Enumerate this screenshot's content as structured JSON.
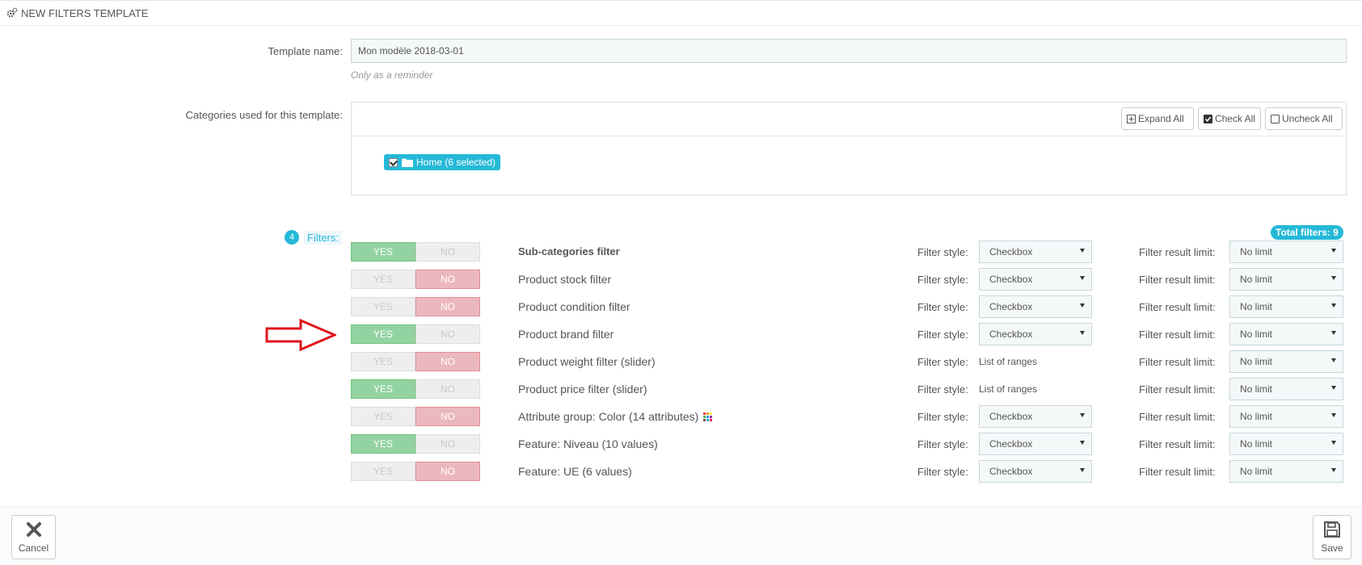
{
  "panel": {
    "title": "New filters template"
  },
  "form": {
    "template_name_label": "Template name:",
    "template_name_value": "Mon modèle 2018-03-01",
    "template_name_help": "Only as a reminder",
    "categories_label": "Categories used for this template:"
  },
  "tree": {
    "expand_all": "Expand All",
    "check_all": "Check All",
    "uncheck_all": "Uncheck All",
    "root_node": "Home (6 selected)"
  },
  "filters": {
    "count": "4",
    "label": "Filters:",
    "total": "Total filters: 9",
    "yes_label": "YES",
    "no_label": "NO",
    "style_label": "Filter style:",
    "limit_label": "Filter result limit:",
    "rows": [
      {
        "name": "Sub-categories filter",
        "enabled": true,
        "style": "Checkbox",
        "style_select": true,
        "limit": "No limit"
      },
      {
        "name": "Product stock filter",
        "enabled": false,
        "style": "Checkbox",
        "style_select": true,
        "limit": "No limit"
      },
      {
        "name": "Product condition filter",
        "enabled": false,
        "style": "Checkbox",
        "style_select": true,
        "limit": "No limit"
      },
      {
        "name": "Product brand filter",
        "enabled": true,
        "style": "Checkbox",
        "style_select": true,
        "limit": "No limit"
      },
      {
        "name": "Product weight filter (slider)",
        "enabled": false,
        "style": "List of ranges",
        "style_select": false,
        "limit": "No limit"
      },
      {
        "name": "Product price filter (slider)",
        "enabled": true,
        "style": "List of ranges",
        "style_select": false,
        "limit": "No limit"
      },
      {
        "name": "Attribute group: Color (14 attributes)",
        "enabled": false,
        "style": "Checkbox",
        "style_select": true,
        "limit": "No limit"
      },
      {
        "name": "Feature: Niveau (10 values)",
        "enabled": true,
        "style": "Checkbox",
        "style_select": true,
        "limit": "No limit"
      },
      {
        "name": "Feature: UE (6 values)",
        "enabled": false,
        "style": "Checkbox",
        "style_select": true,
        "limit": "No limit"
      }
    ]
  },
  "colors": {
    "accent": "#25b9d7",
    "yes_on": "#93d3a2",
    "no_on": "#ebb8be",
    "arrow": "#e0141e"
  },
  "icons": {
    "header": "cogs-icon",
    "arrow": "red-arrow-right-icon",
    "cancel": "close-icon",
    "save": "save-icon"
  },
  "footer": {
    "cancel_label": "Cancel",
    "save_label": "Save"
  }
}
